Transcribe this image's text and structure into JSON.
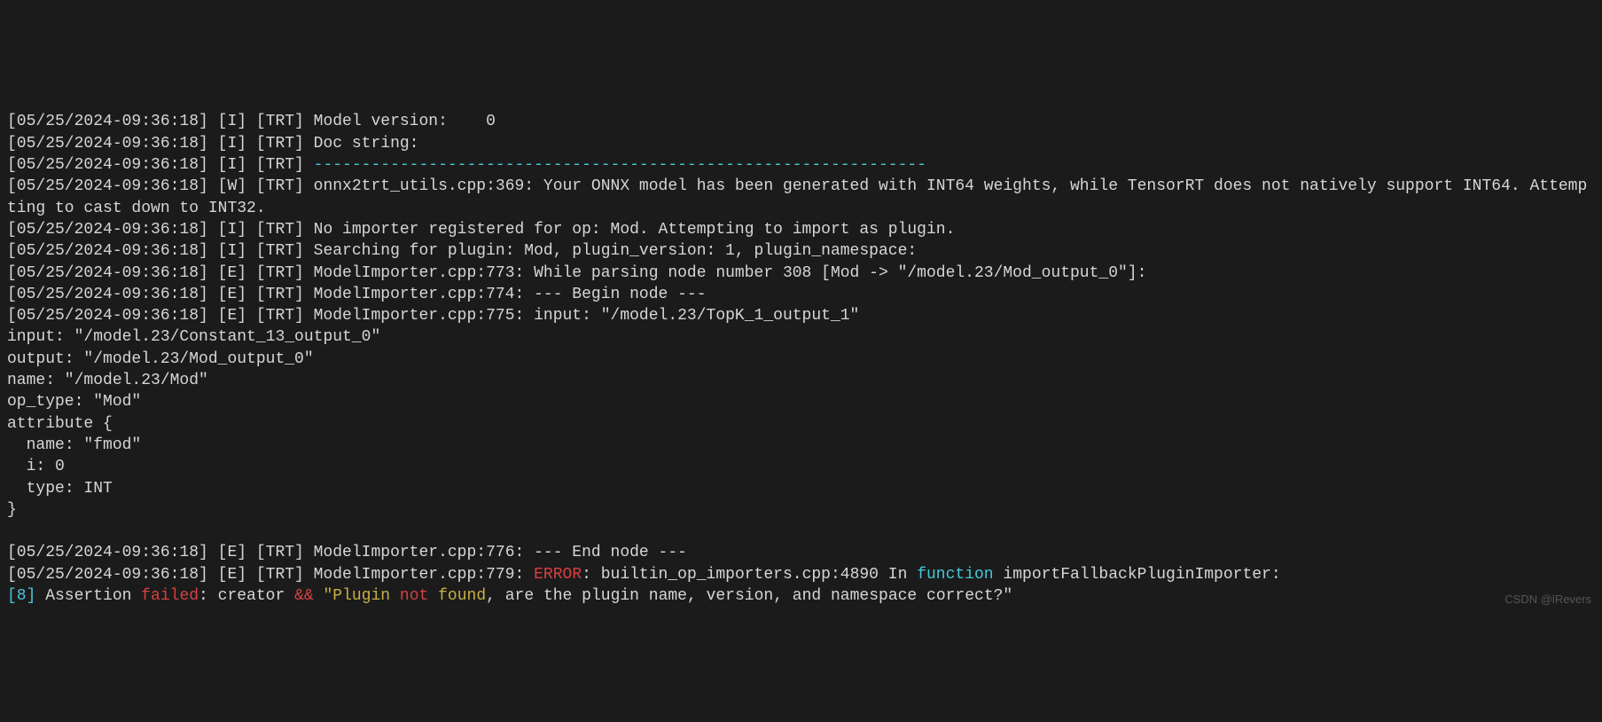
{
  "log": {
    "lines": [
      {
        "text": "[05/25/2024-09:36:18] [I] [TRT] Model version:    0"
      },
      {
        "text": "[05/25/2024-09:36:18] [I] [TRT] Doc string:"
      },
      {
        "prefix": "[05/25/2024-09:36:18] [I] [TRT] ",
        "dash": "----------------------------------------------------------------"
      },
      {
        "text": "[05/25/2024-09:36:18] [W] [TRT] onnx2trt_utils.cpp:369: Your ONNX model has been generated with INT64 weights, while TensorRT does not natively support INT64. Attempting to cast down to INT32."
      },
      {
        "text": "[05/25/2024-09:36:18] [I] [TRT] No importer registered for op: Mod. Attempting to import as plugin."
      },
      {
        "text": "[05/25/2024-09:36:18] [I] [TRT] Searching for plugin: Mod, plugin_version: 1, plugin_namespace:"
      },
      {
        "text": "[05/25/2024-09:36:18] [E] [TRT] ModelImporter.cpp:773: While parsing node number 308 [Mod -> \"/model.23/Mod_output_0\"]:"
      },
      {
        "text": "[05/25/2024-09:36:18] [E] [TRT] ModelImporter.cpp:774: --- Begin node ---"
      },
      {
        "text": "[05/25/2024-09:36:18] [E] [TRT] ModelImporter.cpp:775: input: \"/model.23/TopK_1_output_1\""
      },
      {
        "text": "input: \"/model.23/Constant_13_output_0\""
      },
      {
        "text": "output: \"/model.23/Mod_output_0\""
      },
      {
        "text": "name: \"/model.23/Mod\""
      },
      {
        "text": "op_type: \"Mod\""
      },
      {
        "text": "attribute {"
      },
      {
        "text": "  name: \"fmod\""
      },
      {
        "text": "  i: 0"
      },
      {
        "text": "  type: INT"
      },
      {
        "text": "}"
      },
      {
        "text": ""
      },
      {
        "text": "[05/25/2024-09:36:18] [E] [TRT] ModelImporter.cpp:776: --- End node ---"
      },
      {
        "segments": [
          {
            "t": "[05/25/2024-09:36:18] [E] [TRT] ModelImporter.cpp:779: "
          },
          {
            "t": "ERROR",
            "c": "red"
          },
          {
            "t": ": builtin_op_importers.cpp:4890 In "
          },
          {
            "t": "function",
            "c": "cyan"
          },
          {
            "t": " importFallbackPluginImporter:"
          }
        ]
      },
      {
        "segments": [
          {
            "t": "[8]",
            "c": "cyan"
          },
          {
            "t": " Assertion "
          },
          {
            "t": "failed",
            "c": "red"
          },
          {
            "t": ": creator "
          },
          {
            "t": "&&",
            "c": "red"
          },
          {
            "t": " "
          },
          {
            "t": "\"Plugin ",
            "c": "yellow"
          },
          {
            "t": "not",
            "c": "red"
          },
          {
            "t": " found",
            "c": "yellow"
          },
          {
            "t": ", are the plugin name, version, and namespace correct?\""
          }
        ]
      }
    ]
  },
  "watermark": "CSDN @lRevers"
}
